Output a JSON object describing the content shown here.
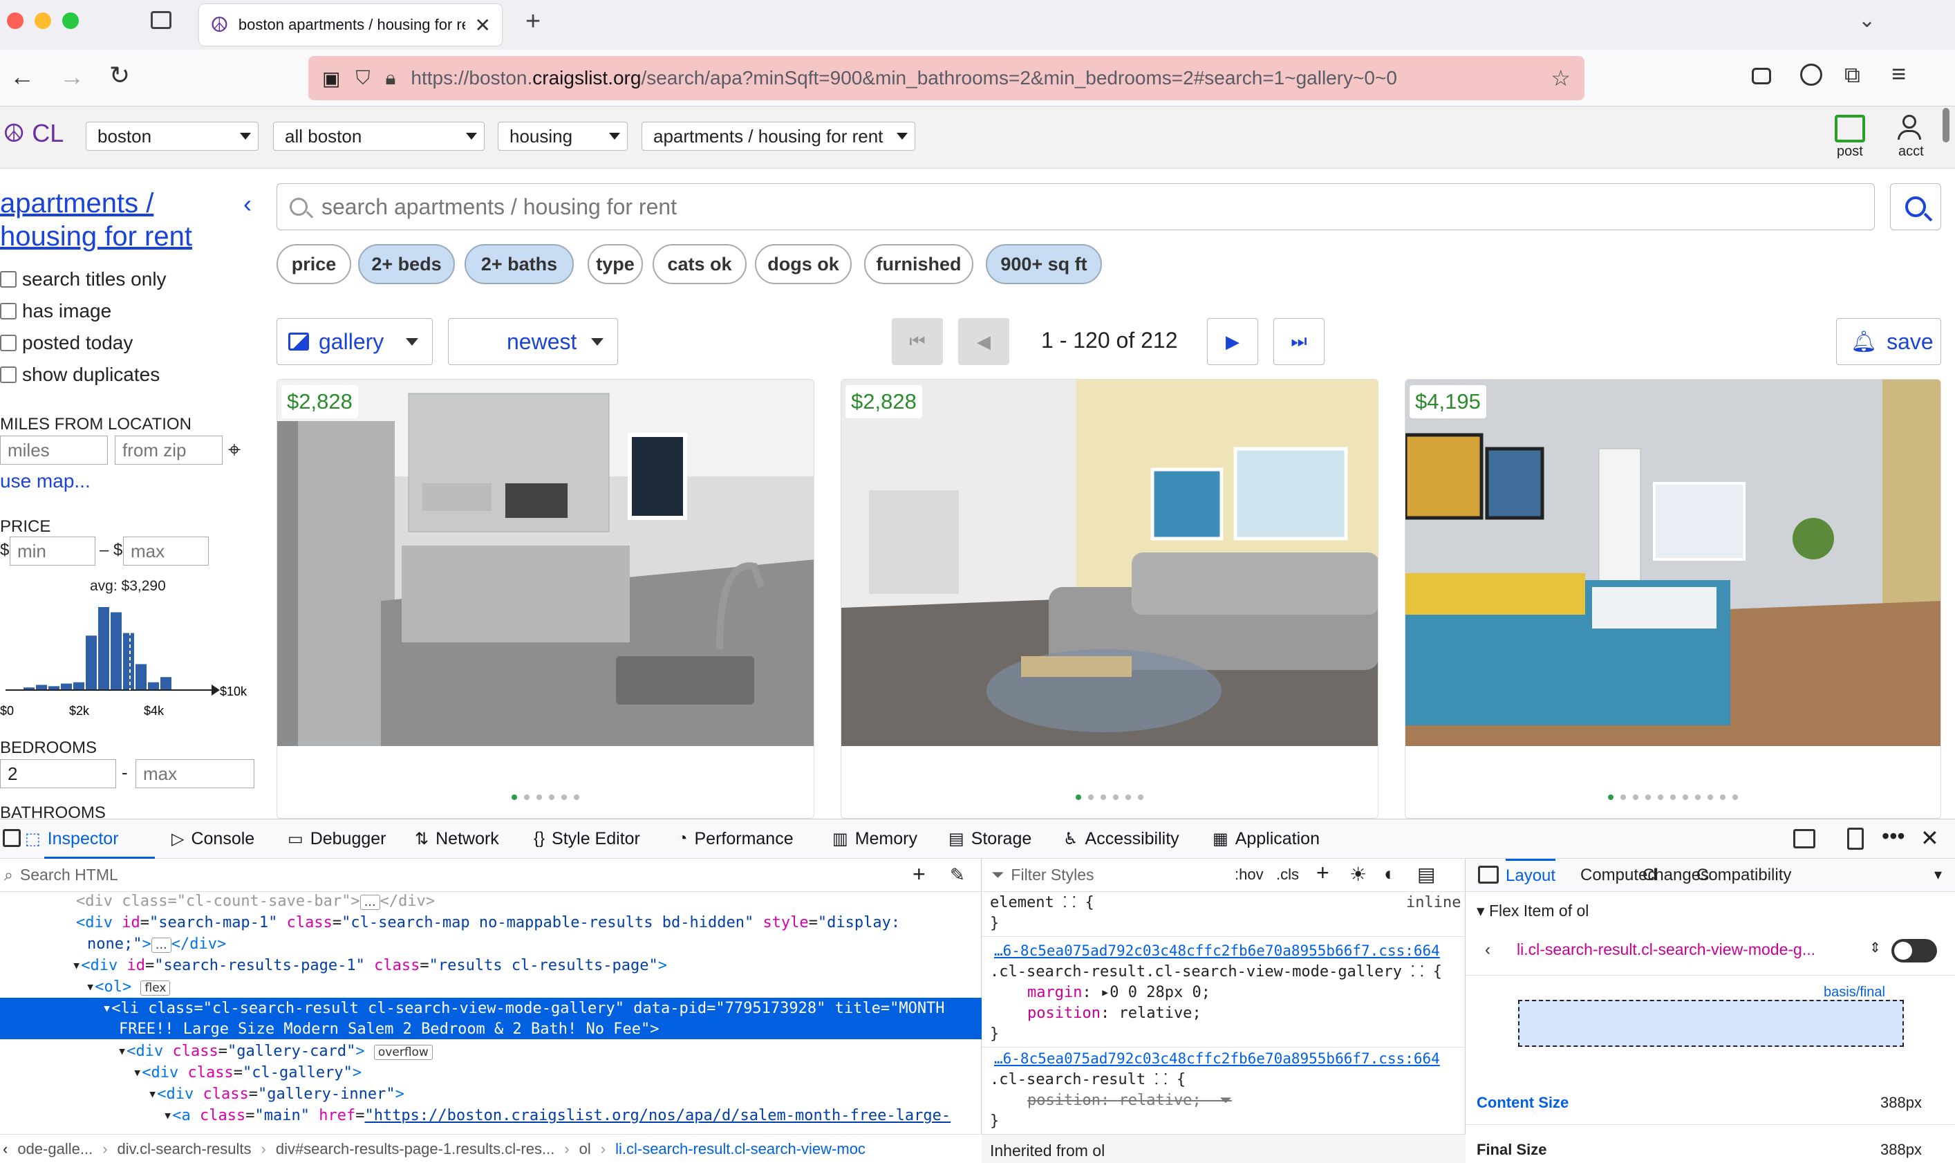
{
  "browser": {
    "tab_title": "boston apartments / housing for rent",
    "url_prefix": "https://boston.",
    "url_domain": "craigslist.org",
    "url_rest": "/search/apa?minSqft=900&min_bathrooms=2&min_bedrooms=2#search=1~gallery~0~0"
  },
  "cl_header": {
    "logo": "CL",
    "selects": [
      "boston",
      "all boston",
      "housing",
      "apartments / housing for rent"
    ],
    "post_label": "post",
    "acct_label": "acct"
  },
  "sidebar": {
    "heading_line1": "apartments /",
    "heading_line2": "housing for rent",
    "checkboxes": [
      "search titles only",
      "has image",
      "posted today",
      "show duplicates"
    ],
    "miles_label": "MILES FROM LOCATION",
    "miles_placeholder": "miles",
    "zip_placeholder": "from zip",
    "use_map": "use map...",
    "price_label": "PRICE",
    "currency": "$",
    "min_placeholder": "min",
    "max_placeholder": "max",
    "dash": "–",
    "avg_label": "avg: $3,290",
    "hist_ticks": [
      "$0",
      "$2k",
      "$4k",
      "$10k"
    ],
    "histogram": [
      0.02,
      0.04,
      0.03,
      0.05,
      0.06,
      0.42,
      0.64,
      0.6,
      0.44,
      0.2,
      0.06,
      0.1
    ],
    "bedrooms_label": "BEDROOMS",
    "bedrooms_min": "2",
    "bedrooms_max_placeholder": "max",
    "bathrooms_label": "BATHROOMS"
  },
  "search": {
    "placeholder": "search apartments / housing for rent",
    "chips": [
      {
        "label": "price",
        "active": false
      },
      {
        "label": "2+ beds",
        "active": true
      },
      {
        "label": "2+ baths",
        "active": true
      },
      {
        "label": "type",
        "active": false
      },
      {
        "label": "cats ok",
        "active": false
      },
      {
        "label": "dogs ok",
        "active": false
      },
      {
        "label": "furnished",
        "active": false
      },
      {
        "label": "900+ sq ft",
        "active": true
      }
    ]
  },
  "controls": {
    "view_mode": "gallery",
    "sort": "newest",
    "range": "1 - 120 of 212",
    "save": "save"
  },
  "cards": [
    {
      "price": "$2,828",
      "dots": 6
    },
    {
      "price": "$2,828",
      "dots": 6
    },
    {
      "price": "$4,195",
      "dots": 11
    }
  ],
  "devtools": {
    "tabs": [
      "Inspector",
      "Console",
      "Debugger",
      "Network",
      "Style Editor",
      "Performance",
      "Memory",
      "Storage",
      "Accessibility",
      "Application"
    ],
    "search_html_placeholder": "Search HTML",
    "filter_styles_placeholder": "Filter Styles",
    "hov": ":hov",
    "cls": ".cls",
    "layout_tabs": [
      "Layout",
      "Computed",
      "Changes",
      "Compatibility"
    ],
    "flex_item_of": "Flex Item of ol",
    "flex_selector": "li.cl-search-result.cl-search-view-mode-g...",
    "basis_final": "basis/final",
    "content_size_label": "Content Size",
    "content_size_value": "388px",
    "final_size_label": "Final Size",
    "final_size_value": "388px",
    "element_rule": "element",
    "inline_label": "inline",
    "css_source": "…6-8c5ea075ad792c03c48cffc2fb6e70a8955b66f7.css:664",
    "rule1_selector": ".cl-search-result.cl-search-view-mode-gallery",
    "rule1_margin_prop": "margin",
    "rule1_margin_val": "0 0 28px 0",
    "rule1_position_prop": "position",
    "rule1_position_val": "relative",
    "rule2_selector": ".cl-search-result",
    "rule2_position_prop": "position",
    "rule2_position_val": "relative",
    "inherited_label": "Inherited from ol",
    "breadcrumbs": [
      "ode-galle...",
      "div.cl-search-results",
      "div#search-results-page-1.results.cl-res...",
      "ol",
      "li.cl-search-result.cl-search-view-moc"
    ]
  }
}
